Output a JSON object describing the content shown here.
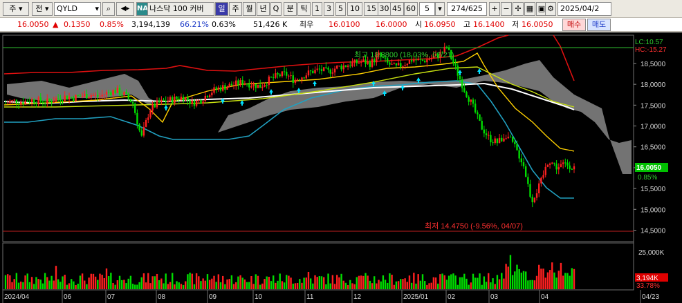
{
  "toolbar": {
    "period_label": "주",
    "sub_label": "전",
    "symbol": "QYLD",
    "market_badge": "NA",
    "market_name": "나스닥 100 커버",
    "periods": [
      "일",
      "주",
      "월",
      "년",
      "Q",
      "분",
      "틱"
    ],
    "minute_buttons": [
      "1",
      "3",
      "5",
      "10",
      "15",
      "30",
      "45",
      "60"
    ],
    "interval_value": "5",
    "page_counter": "274/625",
    "date_value": "2025/04/2"
  },
  "quote": {
    "price": "16.0050",
    "change": "0.1350",
    "change_pct": "0.85%",
    "volume": "3,194,139",
    "vol_ratio": "66.21%",
    "turnover_pct": "0.63%",
    "amount": "51,426 K",
    "best_label": "최우",
    "bid": "16.0100",
    "ask": "16.0000",
    "open_label": "시",
    "open": "16.0950",
    "high_label": "고",
    "high": "16.1400",
    "low_label": "저",
    "low": "16.0050",
    "buy_label": "매수",
    "sell_label": "매도"
  },
  "chart_meta": {
    "lc_label": "LC:10.57",
    "hc_label": "HC:-15.27",
    "max_annotation": "최고 18.8800 (18.03%, 02/21)",
    "min_annotation": "최저 14.4750 (-9.56%, 04/07)",
    "current_price_label": "16.0050",
    "current_pct_label": "0.85%",
    "volume_tick_label": "25,000K",
    "current_volume_label": "3,194K",
    "current_volume_pct": "33.78%",
    "colors": {
      "up": "#ff2020",
      "down": "#00dd00",
      "background": "#000000"
    }
  },
  "chart_data": {
    "type": "candlestick",
    "price_axis_ticks": [
      "18,5000",
      "18,0000",
      "17,5000",
      "17,0000",
      "16,5000",
      "16,0000",
      "15,5000",
      "15,0000",
      "14,5000"
    ],
    "price_axis_values": [
      18.5,
      18.0,
      17.5,
      17.0,
      16.5,
      16.0,
      15.5,
      15.0,
      14.5
    ],
    "ylim": [
      14.4,
      18.95
    ],
    "x_labels": [
      "2024/04",
      "06",
      "07",
      "08",
      "09",
      "10",
      "11",
      "12",
      "2025/01",
      "02",
      "03",
      "04",
      "04/23"
    ],
    "close_series": [
      17.55,
      17.6,
      17.58,
      17.62,
      17.6,
      17.58,
      17.65,
      17.7,
      17.68,
      17.72,
      17.75,
      17.7,
      17.8,
      17.85,
      17.75,
      17.55,
      16.7,
      17.4,
      17.55,
      17.6,
      17.65,
      17.7,
      17.55,
      17.62,
      17.8,
      17.9,
      17.95,
      18.0,
      18.05,
      18.0,
      17.95,
      18.1,
      18.2,
      18.25,
      18.1,
      18.2,
      18.3,
      18.35,
      18.3,
      18.4,
      18.45,
      18.5,
      18.55,
      18.5,
      18.7,
      18.5,
      18.4,
      18.5,
      18.6,
      18.55,
      18.62,
      18.7,
      18.88,
      18.4,
      17.9,
      17.5,
      17.0,
      16.7,
      16.6,
      16.8,
      16.5,
      16.1,
      15.2,
      15.6,
      16.2,
      16.0,
      16.1,
      16.005
    ]
  }
}
